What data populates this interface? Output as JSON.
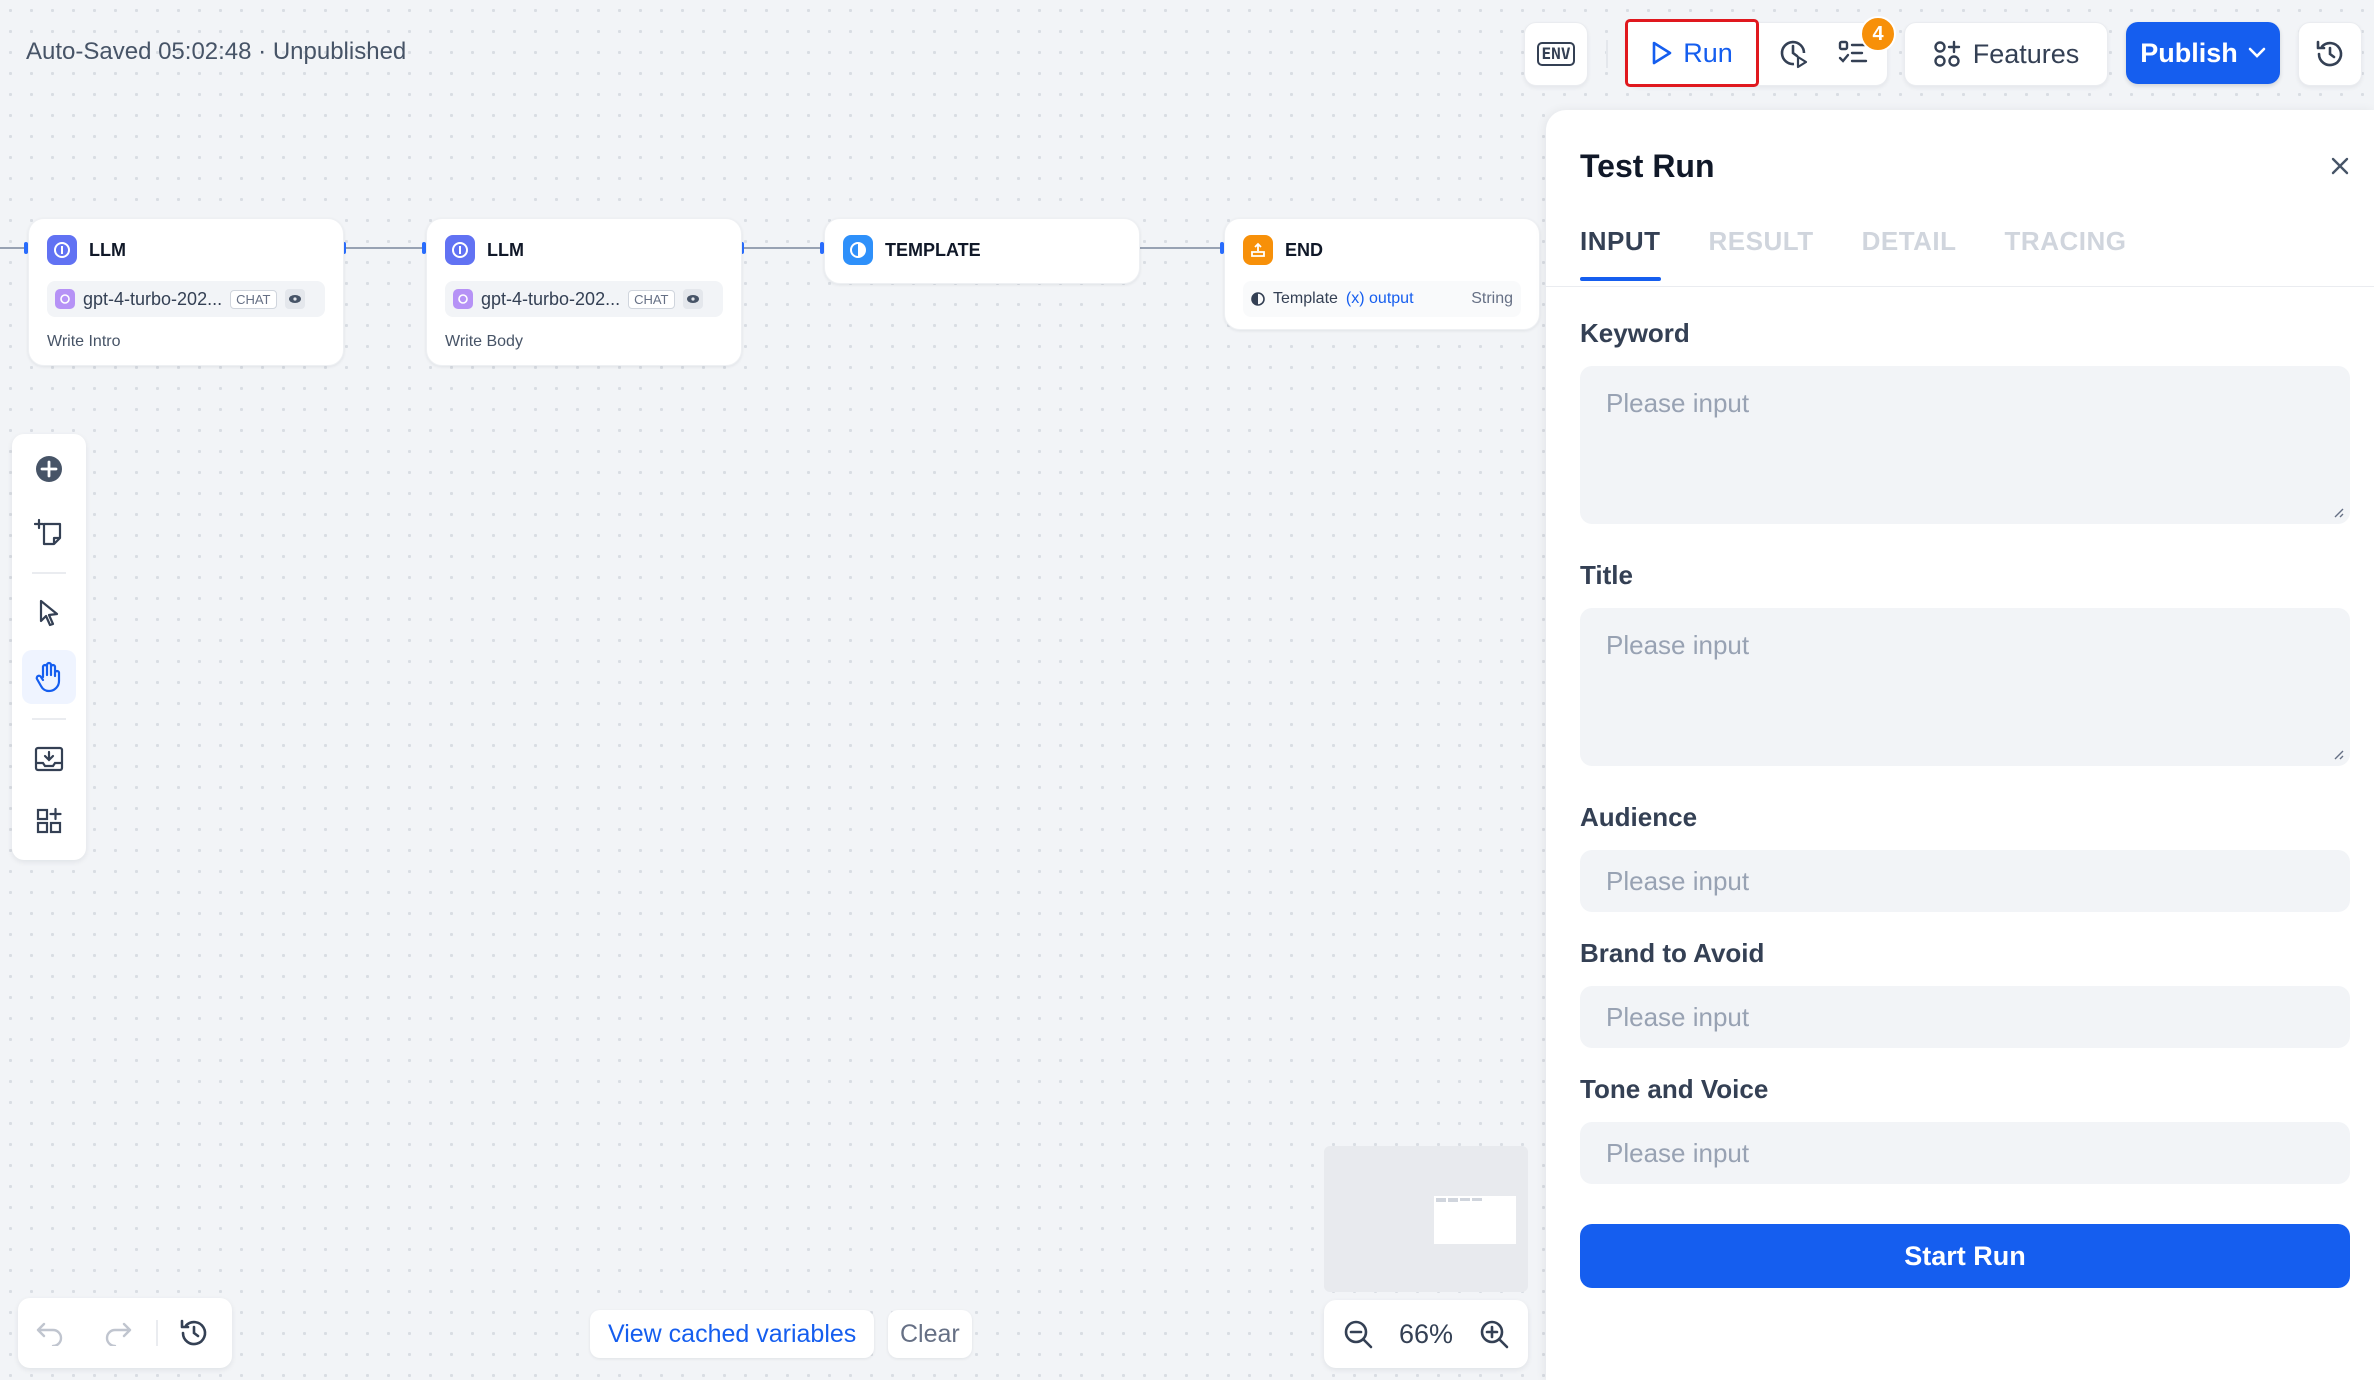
{
  "status": {
    "autosave": "Auto-Saved 05:02:48 · Unpublished"
  },
  "toolbar": {
    "env_label": "ENV",
    "run_label": "Run",
    "checklist_count": "4",
    "features_label": "Features",
    "publish_label": "Publish"
  },
  "nodes": [
    {
      "type": "LLM",
      "model": "gpt-4-turbo-202...",
      "mode": "CHAT",
      "desc": "Write Intro"
    },
    {
      "type": "LLM",
      "model": "gpt-4-turbo-202...",
      "mode": "CHAT",
      "desc": "Write Body"
    },
    {
      "type": "TEMPLATE"
    },
    {
      "type": "END",
      "var_source": "Template",
      "var_name": "(x) output",
      "var_type": "String"
    }
  ],
  "canvas": {
    "cache_label": "View cached variables",
    "clear_label": "Clear",
    "zoom": "66%"
  },
  "panel": {
    "title": "Test Run",
    "tabs": [
      "INPUT",
      "RESULT",
      "DETAIL",
      "TRACING"
    ],
    "fields": [
      {
        "label": "Keyword",
        "placeholder": "Please input"
      },
      {
        "label": "Title",
        "placeholder": "Please input"
      },
      {
        "label": "Audience",
        "placeholder": "Please input"
      },
      {
        "label": "Brand to Avoid",
        "placeholder": "Please input"
      },
      {
        "label": "Tone and Voice",
        "placeholder": "Please input"
      }
    ],
    "start_label": "Start Run"
  },
  "colors": {
    "accent": "#155eef",
    "badge": "#f79009",
    "run_outline": "#e0181e"
  }
}
